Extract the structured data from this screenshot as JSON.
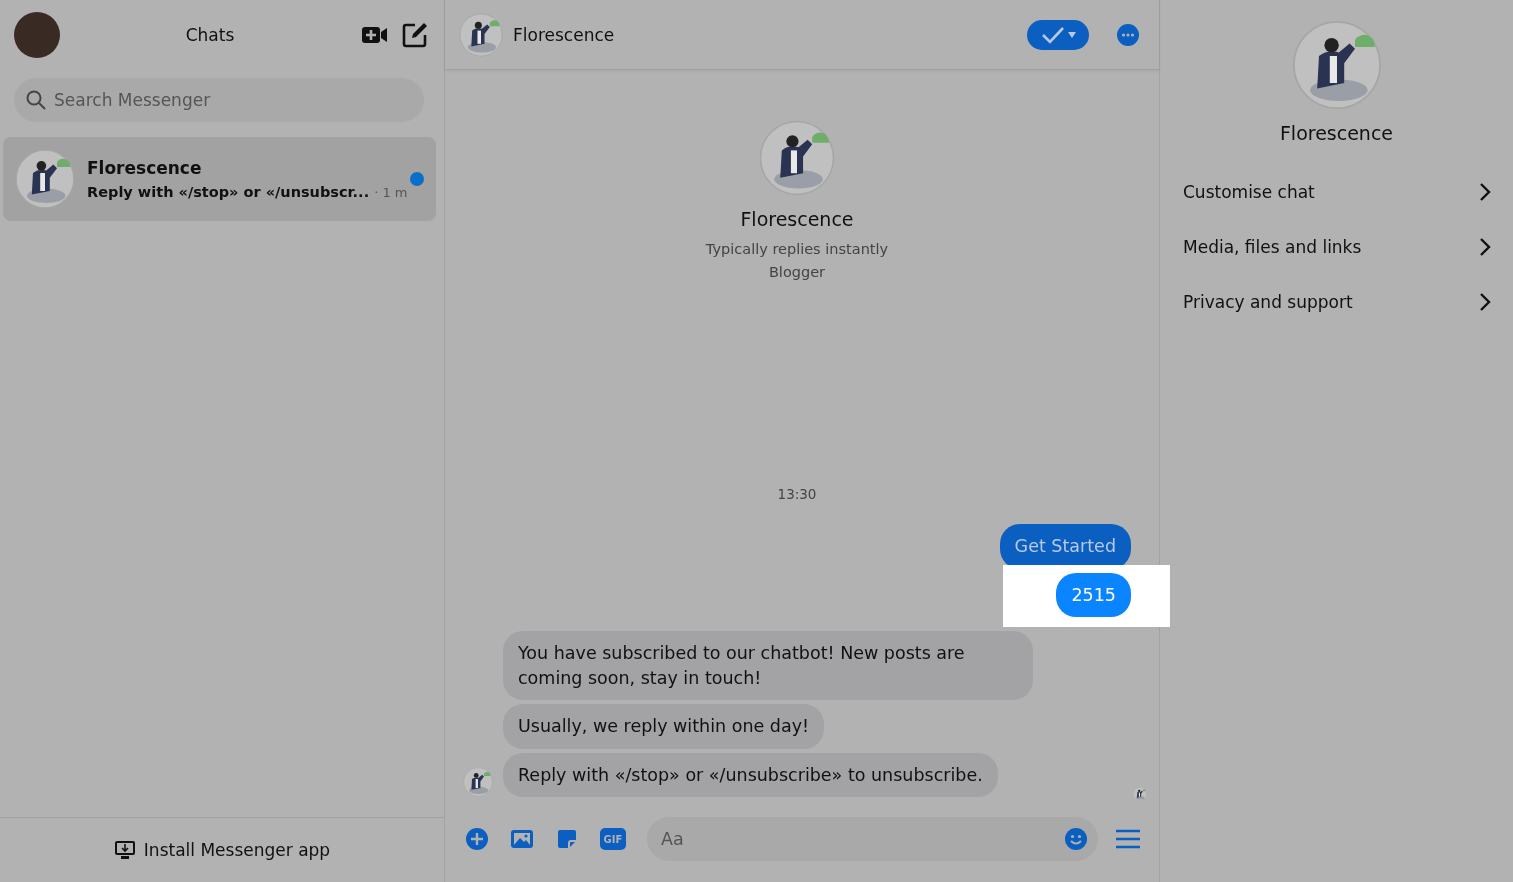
{
  "sidebar": {
    "title": "Chats",
    "search": {
      "placeholder": "Search Messenger"
    },
    "chats": [
      {
        "name": "Florescence",
        "preview": "Reply with «/stop» or «/unsubscr...",
        "time": "· 1 m",
        "unread": true,
        "selected": true
      }
    ],
    "footer": "Install Messenger app"
  },
  "conversation": {
    "header": {
      "name": "Florescence"
    },
    "profile": {
      "name": "Florescence",
      "status": "Typically replies instantly",
      "bio": "Blogger"
    },
    "timestamp": "13:30",
    "messages": [
      {
        "kind": "outgoing",
        "text": "Get Started",
        "highlighted": false
      },
      {
        "kind": "outgoing",
        "text": "2515",
        "highlighted": true
      },
      {
        "kind": "incoming",
        "text": "You have subscribed to our chatbot! New posts are coming soon, stay in touch!",
        "avatar": false
      },
      {
        "kind": "incoming",
        "text": "Usually, we reply within one day!",
        "avatar": false
      },
      {
        "kind": "incoming",
        "text": "Reply with «/stop» or «/unsubscribe» to unsubscribe.",
        "avatar": true
      }
    ],
    "composer": {
      "gif_label": "GIF",
      "placeholder": "Aa"
    }
  },
  "details": {
    "name": "Florescence",
    "items": [
      "Customise chat",
      "Media, files and links",
      "Privacy and support"
    ]
  }
}
